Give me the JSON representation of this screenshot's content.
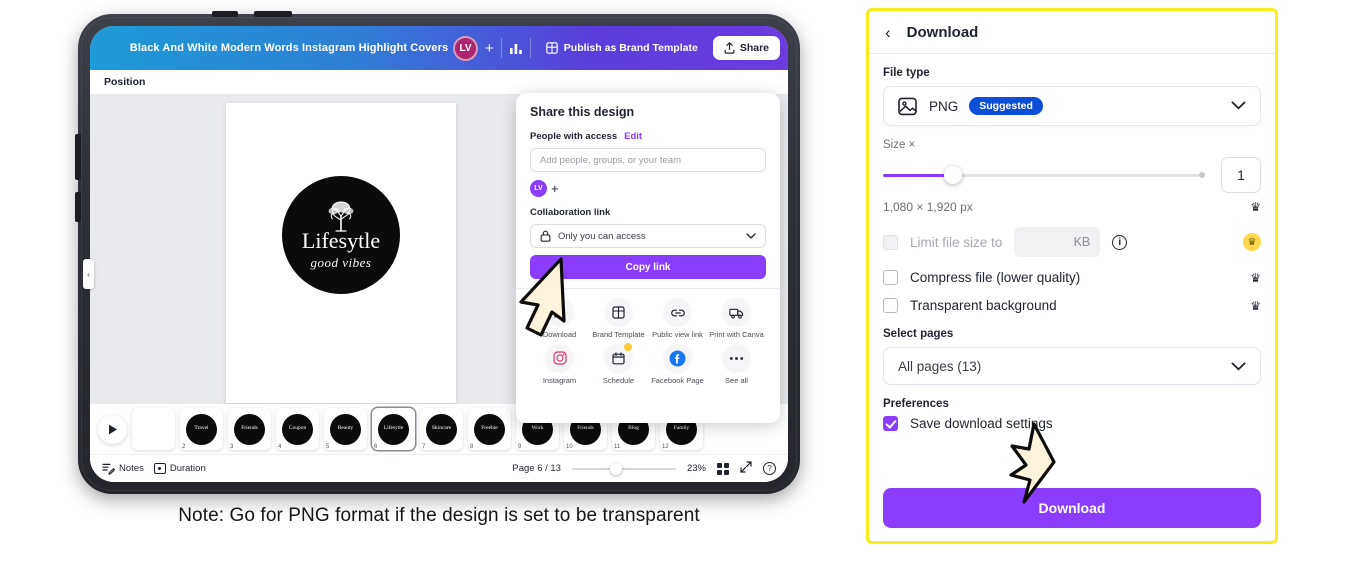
{
  "tablet": {
    "topbar": {
      "doc_title": "Black And White Modern Words Instagram Highlight Covers",
      "avatar_initials": "LV",
      "add_icon": "plus-icon",
      "chart_icon": "analytics-icon",
      "brand_template_label": "Publish as Brand Template",
      "share_label": "Share"
    },
    "position_bar": {
      "label": "Position"
    },
    "canvas": {
      "logo_title": "Lifesytle",
      "logo_subtitle": "good vibes",
      "tree_icon": "tree-icon"
    },
    "share_popover": {
      "title": "Share this design",
      "people_label": "People with access",
      "edit_label": "Edit",
      "people_placeholder": "Add people, groups, or your team",
      "avatar_initials": "LV",
      "add_person_icon": "plus-icon",
      "collab_label": "Collaboration link",
      "access_value": "Only you can access",
      "lock_icon": "lock-icon",
      "copy_link_label": "Copy link",
      "actions": [
        {
          "label": "Download",
          "icon": "download-icon",
          "badge": false
        },
        {
          "label": "Brand Template",
          "icon": "brand-template-icon",
          "badge": false
        },
        {
          "label": "Public view link",
          "icon": "link-icon",
          "badge": false
        },
        {
          "label": "Print with Canva",
          "icon": "print-truck-icon",
          "badge": false
        },
        {
          "label": "Instagram",
          "icon": "instagram-icon",
          "badge": false
        },
        {
          "label": "Schedule",
          "icon": "calendar-icon",
          "badge": true
        },
        {
          "label": "Facebook Page",
          "icon": "facebook-icon",
          "badge": false
        },
        {
          "label": "See all",
          "icon": "more-dots-icon",
          "badge": false
        }
      ]
    },
    "thumbnails": [
      {
        "num": "",
        "label": "",
        "kind": "grid",
        "selected": false
      },
      {
        "num": "2",
        "label": "Travel",
        "kind": "circle",
        "selected": false
      },
      {
        "num": "3",
        "label": "Friends",
        "kind": "circle",
        "selected": false
      },
      {
        "num": "4",
        "label": "Coupon",
        "kind": "circle",
        "selected": false
      },
      {
        "num": "5",
        "label": "Beauty",
        "kind": "circle",
        "selected": false
      },
      {
        "num": "6",
        "label": "Lifesytle",
        "kind": "circle",
        "selected": true
      },
      {
        "num": "7",
        "label": "Skincare",
        "kind": "circle",
        "selected": false
      },
      {
        "num": "8",
        "label": "Freebie",
        "kind": "circle",
        "selected": false
      },
      {
        "num": "9",
        "label": "Work",
        "kind": "circle",
        "selected": false
      },
      {
        "num": "10",
        "label": "Friends",
        "kind": "circle",
        "selected": false
      },
      {
        "num": "11",
        "label": "Blog",
        "kind": "circle",
        "selected": false
      },
      {
        "num": "12",
        "label": "Family",
        "kind": "circle",
        "selected": false
      }
    ],
    "play_icon": "play-icon",
    "statusbar": {
      "notes_label": "Notes",
      "notes_icon": "notes-icon",
      "duration_label": "Duration",
      "duration_icon": "duration-icon",
      "page_indicator": "Page 6 / 13",
      "zoom_level": "23%",
      "grid_icon": "grid-view-icon",
      "fullscreen_icon": "fullscreen-icon",
      "help_icon": "help-icon"
    },
    "collapse_icon": "chevron-left-icon"
  },
  "caption": "Note: Go for PNG format if the design is  set to be transparent",
  "download_panel": {
    "back_icon": "chevron-left-icon",
    "title": "Download",
    "file_type_label": "File type",
    "file_type_value": "PNG",
    "file_type_icon": "image-icon",
    "suggested_badge": "Suggested",
    "chevron_icon": "chevron-down-icon",
    "size_label": "Size ×",
    "size_value": "1",
    "dimensions": "1,080 × 1,920 px",
    "limit_file_size_label": "Limit file size to",
    "limit_file_size_unit": "KB",
    "info_icon": "info-icon",
    "compress_label": "Compress file (lower quality)",
    "transparent_label": "Transparent background",
    "crown_icon": "crown-icon",
    "select_pages_label": "Select pages",
    "select_pages_value": "All pages (13)",
    "preferences_label": "Preferences",
    "save_settings_label": "Save download settings",
    "download_button": "Download",
    "accent_color": "#8b3dff",
    "highlight_border": "#f7ee1e",
    "suggested_color": "#0d4ed8"
  }
}
